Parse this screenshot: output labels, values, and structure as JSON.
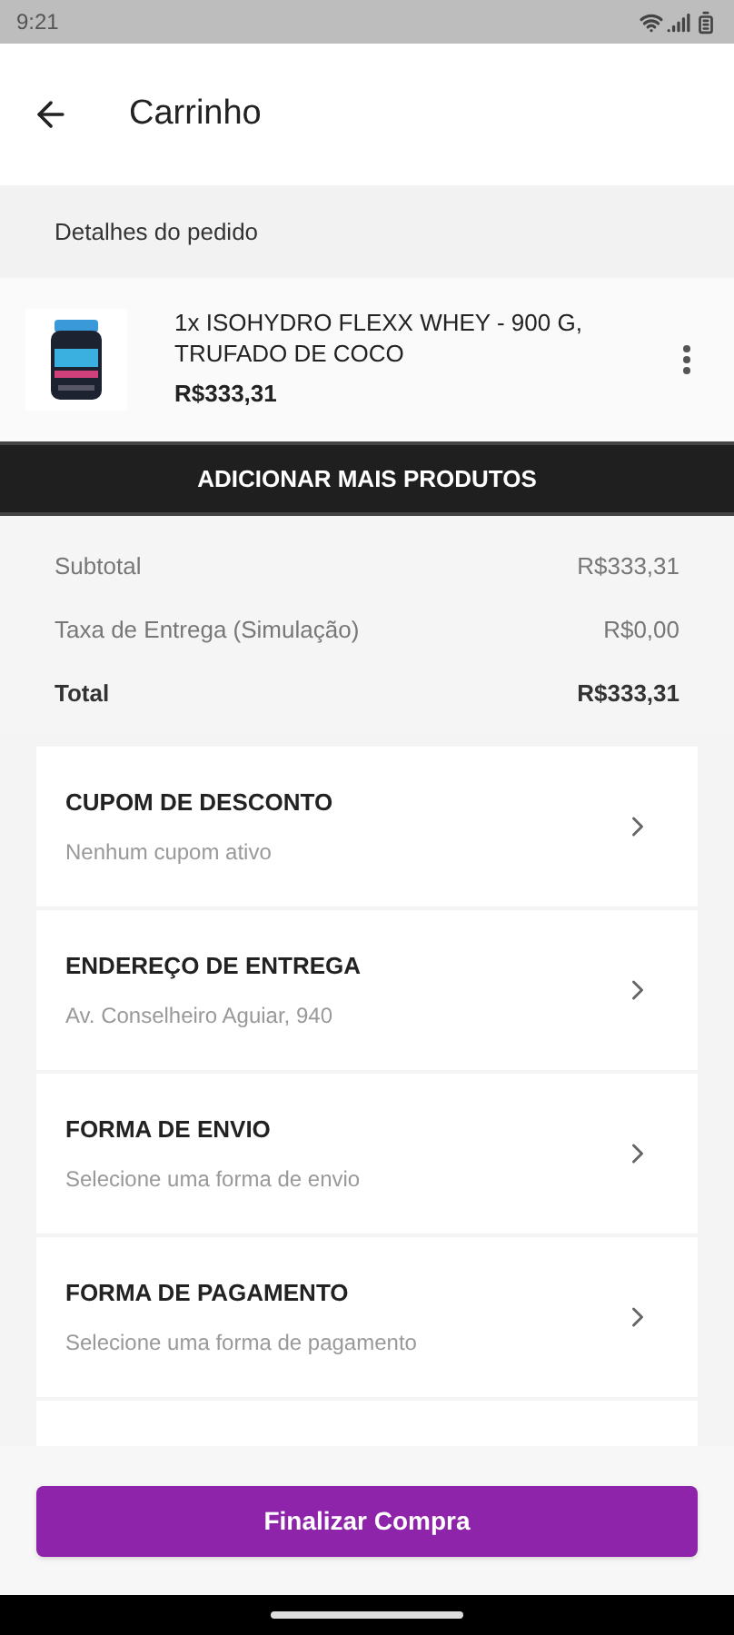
{
  "status_bar": {
    "time": "9:21"
  },
  "header": {
    "title": "Carrinho"
  },
  "order_details": {
    "heading": "Detalhes do pedido"
  },
  "cart_items": [
    {
      "name": "1x ISOHYDRO FLEXX WHEY - 900 G, TRUFADO DE COCO",
      "price": "R$333,31"
    }
  ],
  "add_products_button": "ADICIONAR MAIS PRODUTOS",
  "summary": [
    {
      "label": "Subtotal",
      "value": "R$333,31",
      "kind": "normal"
    },
    {
      "label": "Taxa de Entrega (Simulação)",
      "value": "R$0,00",
      "kind": "normal"
    },
    {
      "label": "Total",
      "value": "R$333,31",
      "kind": "total"
    }
  ],
  "options": [
    {
      "title": "CUPOM DE DESCONTO",
      "subtitle": "Nenhum cupom ativo"
    },
    {
      "title": "ENDEREÇO DE ENTREGA",
      "subtitle": "Av. Conselheiro Aguiar, 940"
    },
    {
      "title": "FORMA DE ENVIO",
      "subtitle": "Selecione uma forma de envio"
    },
    {
      "title": "FORMA DE PAGAMENTO",
      "subtitle": "Selecione uma forma de pagamento"
    }
  ],
  "checkout_button": "Finalizar Compra"
}
